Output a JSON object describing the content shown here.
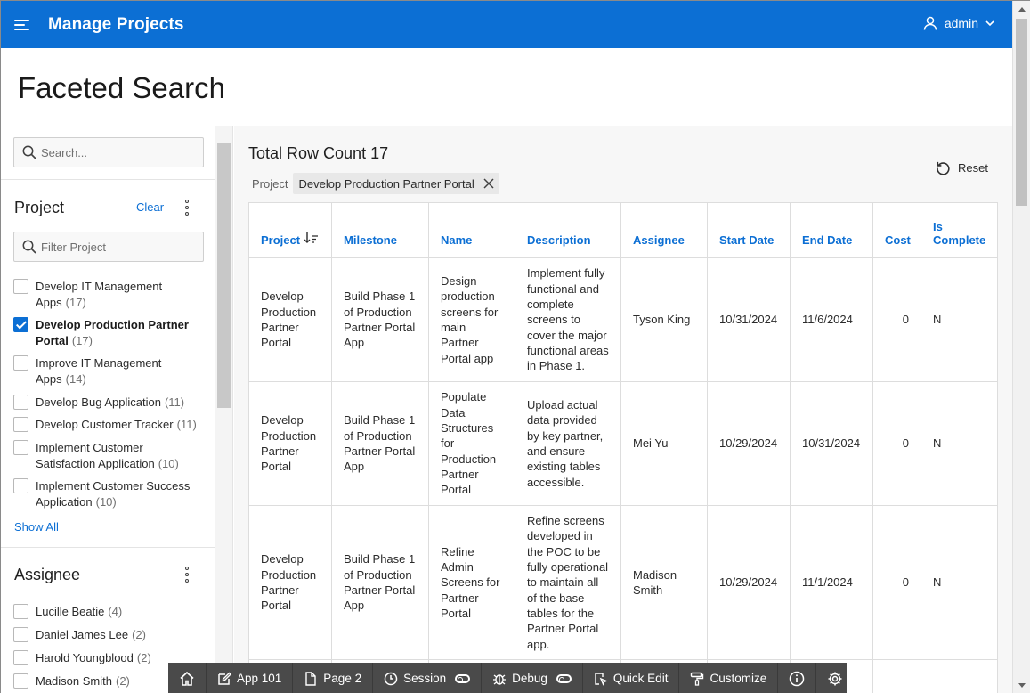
{
  "header": {
    "app_title": "Manage Projects",
    "user_name": "admin"
  },
  "page": {
    "title": "Faceted Search"
  },
  "search": {
    "placeholder": "Search..."
  },
  "facets": {
    "project": {
      "title": "Project",
      "clear_label": "Clear",
      "filter_placeholder": "Filter Project",
      "options": [
        {
          "label": "Develop IT Management Apps",
          "count": "(17)",
          "checked": false
        },
        {
          "label": "Develop Production Partner Portal",
          "count": "(17)",
          "checked": true
        },
        {
          "label": "Improve IT Management Apps",
          "count": "(14)",
          "checked": false
        },
        {
          "label": "Develop Bug Application",
          "count": "(11)",
          "checked": false
        },
        {
          "label": "Develop Customer Tracker",
          "count": "(11)",
          "checked": false
        },
        {
          "label": "Implement Customer Satisfaction Application",
          "count": "(10)",
          "checked": false
        },
        {
          "label": "Implement Customer Success Application",
          "count": "(10)",
          "checked": false
        }
      ],
      "show_all_label": "Show All"
    },
    "assignee": {
      "title": "Assignee",
      "options": [
        {
          "label": "Lucille Beatie",
          "count": "(4)"
        },
        {
          "label": "Daniel James Lee",
          "count": "(2)"
        },
        {
          "label": "Harold Youngblood",
          "count": "(2)"
        },
        {
          "label": "Madison Smith",
          "count": "(2)"
        }
      ]
    }
  },
  "results": {
    "row_count_label": "Total Row Count 17",
    "reset_label": "Reset",
    "active_filter": {
      "facet": "Project",
      "value": "Develop Production Partner Portal"
    },
    "columns": {
      "project": "Project",
      "milestone": "Milestone",
      "name": "Name",
      "description": "Description",
      "assignee": "Assignee",
      "start_date": "Start Date",
      "end_date": "End Date",
      "cost": "Cost",
      "is_complete": "Is Complete"
    },
    "rows": [
      {
        "project": "Develop Production Partner Portal",
        "milestone": "Build Phase 1 of Production Partner Portal App",
        "name": "Design production screens for main Partner Portal app",
        "description": "Implement fully functional and complete screens to cover the major functional areas in Phase 1.",
        "assignee": "Tyson King",
        "start_date": "10/31/2024",
        "end_date": "11/6/2024",
        "cost": "0",
        "is_complete": "N"
      },
      {
        "project": "Develop Production Partner Portal",
        "milestone": "Build Phase 1 of Production Partner Portal App",
        "name": "Populate Data Structures for Production Partner Portal",
        "description": "Upload actual data provided by key partner, and ensure existing tables accessible.",
        "assignee": "Mei Yu",
        "start_date": "10/29/2024",
        "end_date": "10/31/2024",
        "cost": "0",
        "is_complete": "N"
      },
      {
        "project": "Develop Production Partner Portal",
        "milestone": "Build Phase 1 of Production Partner Portal App",
        "name": "Refine Admin Screens for Partner Portal",
        "description": "Refine screens developed in the POC to be fully operational to maintain all of the base tables for the Partner Portal app.",
        "assignee": "Madison Smith",
        "start_date": "10/29/2024",
        "end_date": "11/1/2024",
        "cost": "0",
        "is_complete": "N"
      }
    ]
  },
  "devbar": {
    "home_icon": "home-icon",
    "app_label": "App 101",
    "page_label": "Page 2",
    "session_label": "Session",
    "debug_label": "Debug",
    "quick_edit_label": "Quick Edit",
    "customize_label": "Customize"
  },
  "colors": {
    "header_bg": "#0c6fd4",
    "link": "#0c6fd4",
    "devbar_bg": "#4a4a4a"
  }
}
